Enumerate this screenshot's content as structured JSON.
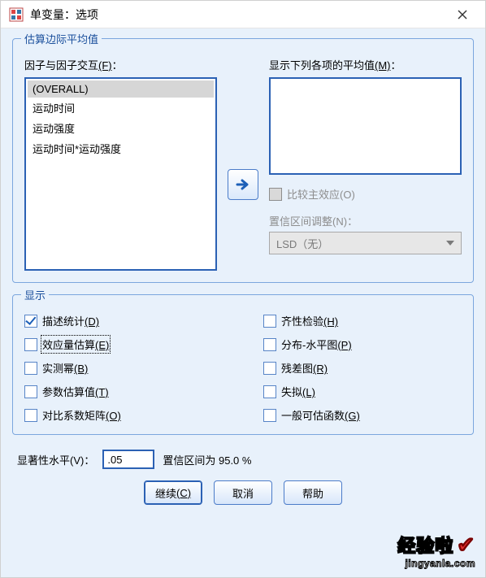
{
  "window": {
    "title": "单变量：选项"
  },
  "group_estimate": {
    "legend": "估算边际平均值",
    "factors_label": "因子与因子交互",
    "factors_accel": "(F)",
    "factors_items": [
      "(OVERALL)",
      "运动时间",
      "运动强度",
      "运动时间*运动强度"
    ],
    "means_label": "显示下列各项的平均值",
    "means_accel": "(M)",
    "compare_label": "比较主效应",
    "compare_accel": "(O)",
    "ci_adjust_label": "置信区间调整",
    "ci_adjust_accel": "(N)",
    "ci_adjust_value": "LSD（无）"
  },
  "group_display": {
    "legend": "显示",
    "options": [
      {
        "label": "描述统计",
        "accel": "(D)",
        "checked": true,
        "focus": false
      },
      {
        "label": "齐性检验",
        "accel": "(H)",
        "checked": false,
        "focus": false
      },
      {
        "label": "效应量估算",
        "accel": "(E)",
        "checked": false,
        "focus": true
      },
      {
        "label": "分布-水平图",
        "accel": "(P)",
        "checked": false,
        "focus": false
      },
      {
        "label": "实测幂",
        "accel": "(B)",
        "checked": false,
        "focus": false
      },
      {
        "label": "残差图",
        "accel": "(R)",
        "checked": false,
        "focus": false
      },
      {
        "label": "参数估算值",
        "accel": "(T)",
        "checked": false,
        "focus": false
      },
      {
        "label": "失拟",
        "accel": "(L)",
        "checked": false,
        "focus": false
      },
      {
        "label": "对比系数矩阵",
        "accel": "(O)",
        "checked": false,
        "focus": false
      },
      {
        "label": "一般可估函数",
        "accel": "(G)",
        "checked": false,
        "focus": false
      }
    ]
  },
  "significance": {
    "label": "显著性水平",
    "accel": "(V)",
    "value": ".05",
    "ci_text": "置信区间为 95.0 %"
  },
  "buttons": {
    "continue": "继续",
    "continue_accel": "(C)",
    "cancel": "取消",
    "help": "帮助"
  },
  "watermark": {
    "line1": "经验啦",
    "line2": "jingyanla.com"
  }
}
